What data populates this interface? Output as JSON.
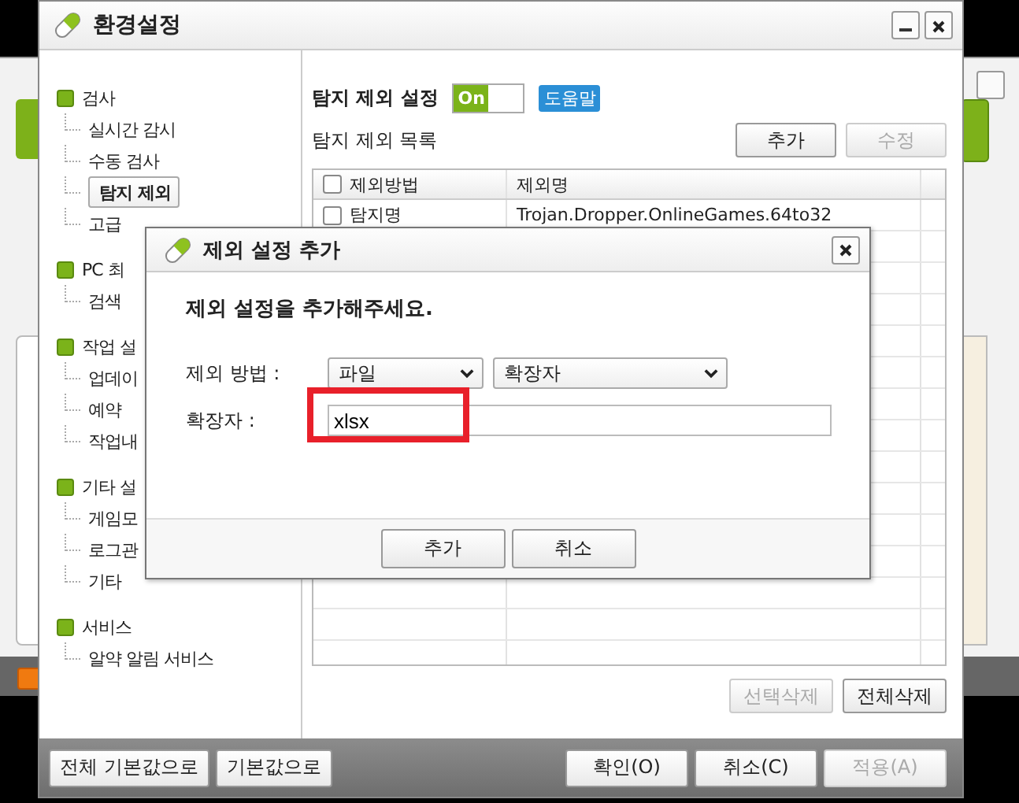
{
  "window": {
    "title": "환경설정"
  },
  "sidebar": {
    "groups": [
      {
        "label": "검사",
        "items": [
          {
            "label": "실시간 감시",
            "selected": false
          },
          {
            "label": "수동 검사",
            "selected": false
          },
          {
            "label": "탐지 제외",
            "selected": true
          },
          {
            "label": "고급",
            "selected": false
          }
        ]
      },
      {
        "label": "PC 최",
        "items": [
          {
            "label": "검색",
            "selected": false
          }
        ]
      },
      {
        "label": "작업 설",
        "items": [
          {
            "label": "업데이",
            "selected": false
          },
          {
            "label": "예약",
            "selected": false
          },
          {
            "label": "작업내",
            "selected": false
          }
        ]
      },
      {
        "label": "기타 설",
        "items": [
          {
            "label": "게임모",
            "selected": false
          },
          {
            "label": "로그관",
            "selected": false
          },
          {
            "label": "기타",
            "selected": false
          }
        ]
      },
      {
        "label": "서비스",
        "items": [
          {
            "label": "알약 알림 서비스",
            "selected": false
          }
        ]
      }
    ]
  },
  "content": {
    "title": "탐지 제외 설정",
    "toggle": {
      "label": "On",
      "on": true
    },
    "help": "도움말",
    "list_label": "탐지 제외 목록",
    "buttons": [
      {
        "label": "추가",
        "disabled": false
      },
      {
        "label": "수정",
        "disabled": true
      }
    ],
    "table": {
      "columns": [
        "제외방법",
        "제외명"
      ],
      "header_checked": false,
      "rows": [
        {
          "checked": false,
          "cells": [
            "탐지명",
            "Trojan.Dropper.OnlineGames.64to32"
          ]
        }
      ]
    },
    "bottom_buttons": [
      {
        "label": "선택삭제",
        "disabled": true
      },
      {
        "label": "전체삭제",
        "disabled": false
      }
    ]
  },
  "footer": {
    "left_buttons": [
      {
        "label": "전체 기본값으로",
        "disabled": false
      },
      {
        "label": "기본값으로",
        "disabled": false
      }
    ],
    "right_buttons": [
      {
        "label": "확인(O)",
        "disabled": false
      },
      {
        "label": "취소(C)",
        "disabled": false
      },
      {
        "label": "적용(A)",
        "disabled": true
      }
    ]
  },
  "dialog": {
    "title": "제외 설정 추가",
    "prompt": "제외 설정을 추가해주세요.",
    "method_label": "제외 방법 :",
    "selects": [
      "파일",
      "확장자"
    ],
    "field_label": "확장자 :",
    "field_value": "xlsx",
    "highlight": true,
    "buttons": [
      "추가",
      "취소"
    ]
  }
}
